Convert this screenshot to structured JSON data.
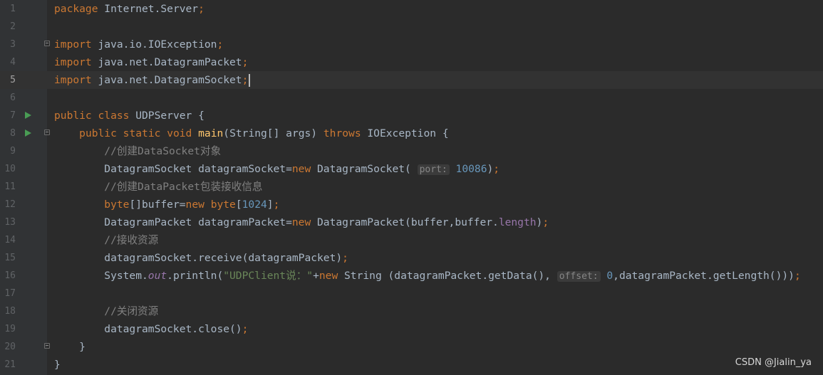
{
  "editor": {
    "current_line": 5,
    "lines": [
      {
        "n": "1",
        "code": "package Internet.Server;"
      },
      {
        "n": "2",
        "code": ""
      },
      {
        "n": "3",
        "code": "import java.io.IOException;"
      },
      {
        "n": "4",
        "code": "import java.net.DatagramPacket;"
      },
      {
        "n": "5",
        "code": "import java.net.DatagramSocket;"
      },
      {
        "n": "6",
        "code": ""
      },
      {
        "n": "7",
        "code": "public class UDPServer {"
      },
      {
        "n": "8",
        "code": "    public static void main(String[] args) throws IOException {"
      },
      {
        "n": "9",
        "code": "        //创建DataSocket对象"
      },
      {
        "n": "10",
        "code": "        DatagramSocket datagramSocket=new DatagramSocket( port: 10086);"
      },
      {
        "n": "11",
        "code": "        //创建DataPacket包装接收信息"
      },
      {
        "n": "12",
        "code": "        byte[]buffer=new byte[1024];"
      },
      {
        "n": "13",
        "code": "        DatagramPacket datagramPacket=new DatagramPacket(buffer,buffer.length);"
      },
      {
        "n": "14",
        "code": "        //接收资源"
      },
      {
        "n": "15",
        "code": "        datagramSocket.receive(datagramPacket);"
      },
      {
        "n": "16",
        "code": "        System.out.println(\"UDPClient说：\"+new String (datagramPacket.getData(), offset: 0,datagramPacket.getLength()));"
      },
      {
        "n": "17",
        "code": ""
      },
      {
        "n": "18",
        "code": "        //关闭资源"
      },
      {
        "n": "19",
        "code": "        datagramSocket.close();"
      },
      {
        "n": "20",
        "code": "    }"
      },
      {
        "n": "21",
        "code": "}"
      }
    ],
    "run_markers": [
      "7",
      "8"
    ],
    "fold_markers": [
      "3",
      "8",
      "20"
    ]
  },
  "watermark": "CSDN @Jialin_ya",
  "colors": {
    "background": "#2b2b2b",
    "gutter": "#313335",
    "keyword": "#cc7832",
    "comment": "#808080",
    "number": "#6897bb",
    "string": "#6a8759",
    "method_decl": "#ffc66d",
    "field": "#9876aa",
    "default_text": "#a9b7c6",
    "run_icon": "#499c54"
  }
}
